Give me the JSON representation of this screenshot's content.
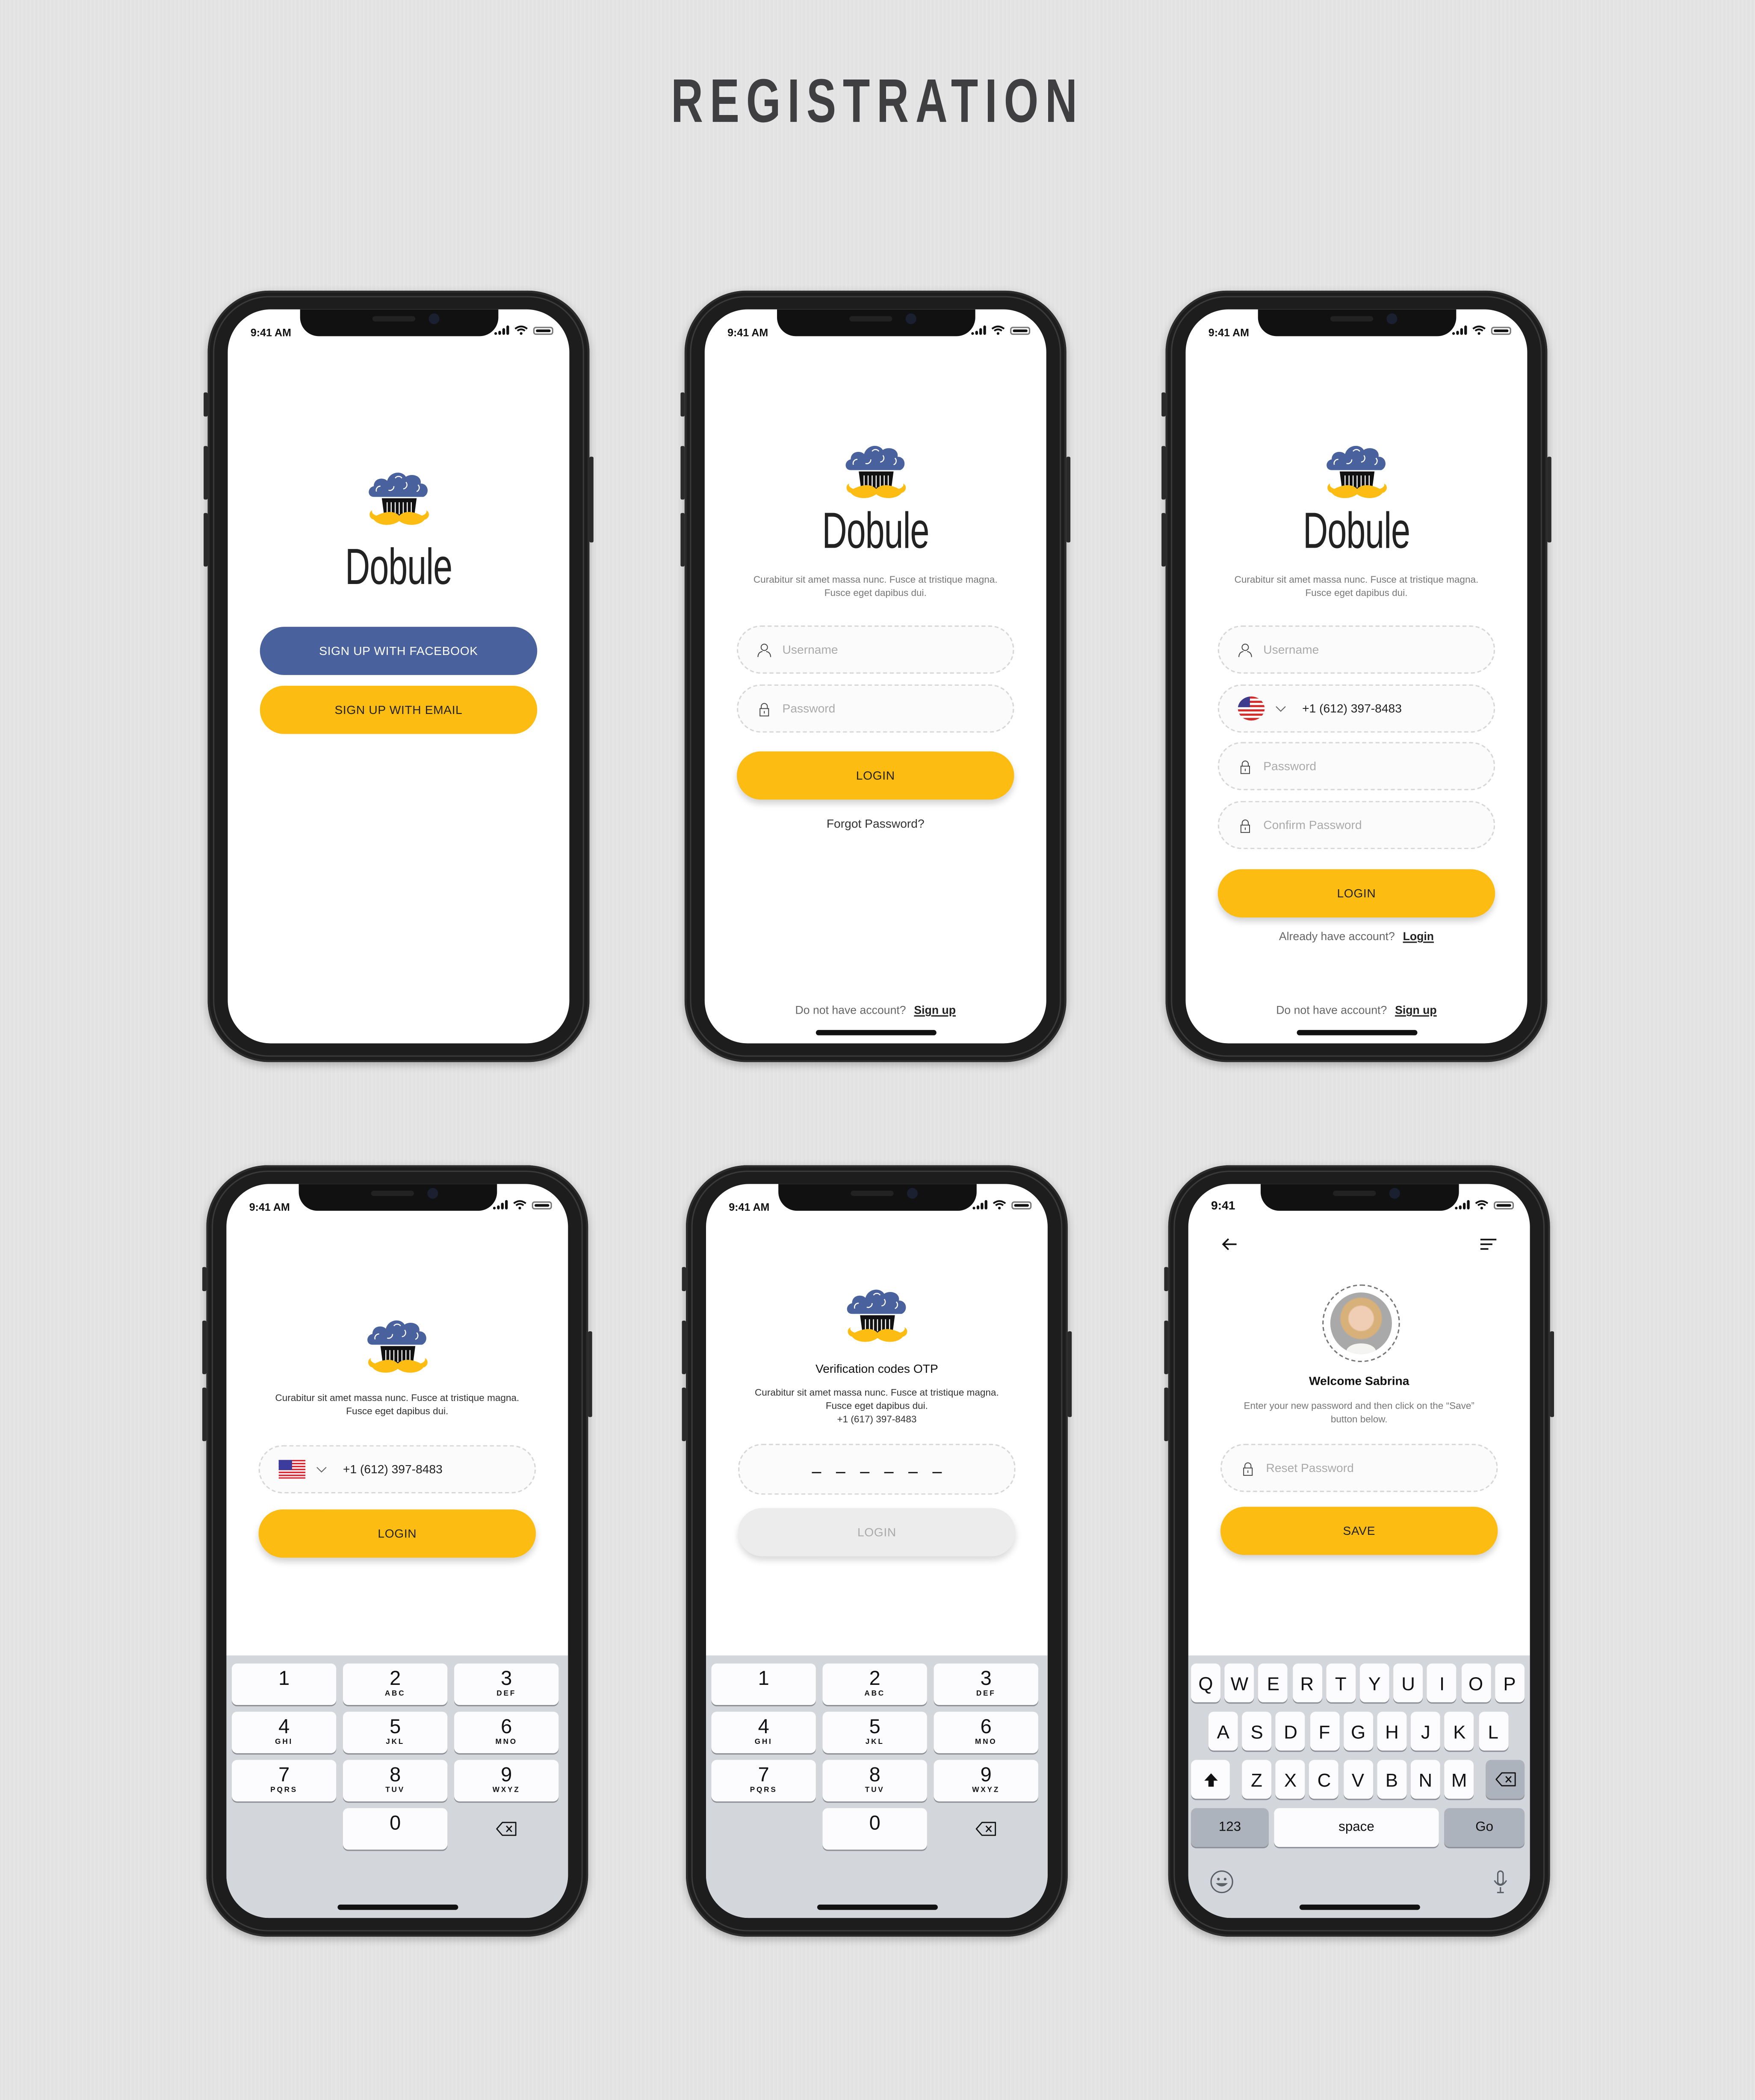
{
  "page": {
    "title": "REGISTRATION"
  },
  "colors": {
    "facebook": "#49629e",
    "accent": "#fdbc12",
    "disabled": "#ececec",
    "keyboard_bg": "#d3d6db"
  },
  "screens": {
    "welcome": {
      "time": "9:41 AM",
      "brand": "Dobule",
      "facebook_button": "SIGN UP WITH FACEBOOK",
      "email_button": "SIGN UP WITH EMAIL"
    },
    "login": {
      "time": "9:41 AM",
      "brand": "Dobule",
      "tagline_1": "Curabitur sit amet massa nunc. Fusce at tristique magna.",
      "tagline_2": "Fusce eget dapibus dui.",
      "username_placeholder": "Username",
      "password_placeholder": "Password",
      "login_button": "LOGIN",
      "forgot_password": "Forgot Password?",
      "footer_text": "Do not have account?",
      "footer_link": "Sign up"
    },
    "signup": {
      "time": "9:41 AM",
      "brand": "Dobule",
      "tagline_1": "Curabitur sit amet massa nunc. Fusce at tristique magna.",
      "tagline_2": "Fusce eget dapibus dui.",
      "username_placeholder": "Username",
      "country": "us-flag",
      "phone_value": "+1 (612) 397-8483",
      "password_placeholder": "Password",
      "confirm_placeholder": "Confirm Password",
      "login_button": "LOGIN",
      "already_text": "Already have account?",
      "already_link": "Login",
      "footer_text": "Do not have account?",
      "footer_link": "Sign up"
    },
    "phone_login": {
      "time": "9:41 AM",
      "tagline_1": "Curabitur sit amet massa nunc. Fusce at tristique magna.",
      "tagline_2": "Fusce eget dapibus dui.",
      "country": "us-flag",
      "phone_value": "+1 (612) 397-8483",
      "login_button": "LOGIN"
    },
    "otp": {
      "time": "9:41 AM",
      "heading": "Verification codes OTP",
      "tagline_1": "Curabitur sit amet massa nunc. Fusce at tristique magna.",
      "tagline_2": "Fusce eget dapibus dui.",
      "phone": "+1 (617) 397-8483",
      "otp_slots": 6,
      "login_button": "LOGIN"
    },
    "reset": {
      "time": "9:41",
      "back_icon": "arrow-left-icon",
      "menu_icon": "menu-icon",
      "heading": "Welcome Sabrina",
      "instructions_1": "Enter your new password and then click on the “Save”",
      "instructions_2": "button below.",
      "password_placeholder": "Reset Password",
      "save_button": "SAVE"
    }
  },
  "numpad": [
    {
      "digit": "1",
      "letters": ""
    },
    {
      "digit": "2",
      "letters": "ABC"
    },
    {
      "digit": "3",
      "letters": "DEF"
    },
    {
      "digit": "4",
      "letters": "GHI"
    },
    {
      "digit": "5",
      "letters": "JKL"
    },
    {
      "digit": "6",
      "letters": "MNO"
    },
    {
      "digit": "7",
      "letters": "PQRS"
    },
    {
      "digit": "8",
      "letters": "TUV"
    },
    {
      "digit": "9",
      "letters": "WXYZ"
    },
    {
      "digit": "0",
      "letters": ""
    }
  ],
  "keyboard": {
    "row1": [
      "Q",
      "W",
      "E",
      "R",
      "T",
      "Y",
      "U",
      "I",
      "O",
      "P"
    ],
    "row2": [
      "A",
      "S",
      "D",
      "F",
      "G",
      "H",
      "J",
      "K",
      "L"
    ],
    "row3": [
      "Z",
      "X",
      "C",
      "V",
      "B",
      "N",
      "M"
    ],
    "numbers_key": "123",
    "space_key": "space",
    "go_key": "Go"
  }
}
